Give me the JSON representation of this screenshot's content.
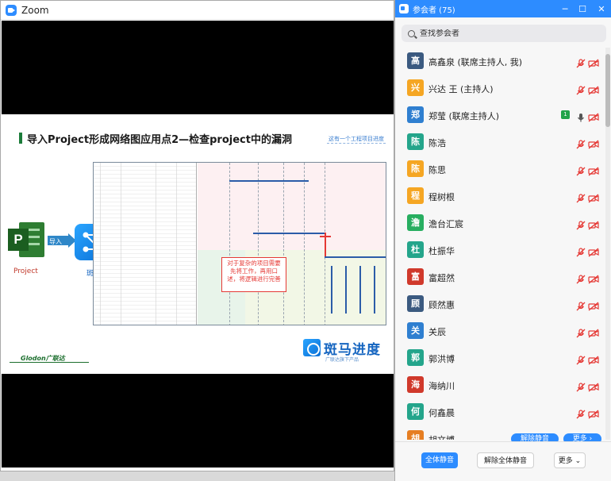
{
  "zoom_window": {
    "title": "Zoom"
  },
  "slide": {
    "title": "导入Project形成网络图应用点2—检查project中的漏洞",
    "tag": "这有一个工程项目进度",
    "project_label": "Project",
    "import_label": "导入",
    "banma_label": "斑马",
    "callout": "对于复杂的项目需要先将工作，再用口述，将逻辑进行完善",
    "brand_name": "斑马进度",
    "brand_slogan": "广联达旗下产品",
    "glodon": "Glodon广联达"
  },
  "panel": {
    "title": "参会者 (75)",
    "search_placeholder": "查找参会者",
    "colors": {
      "accent": "#2d8cff",
      "mic_muted": "#e53935"
    },
    "participants": [
      {
        "initial": "高",
        "name": "高鑫泉 (联席主持人, 我)",
        "color": "#3b5a80",
        "mic": "muted",
        "cam": "off"
      },
      {
        "initial": "兴",
        "name": "兴达 王 (主持人)",
        "color": "#f5a623",
        "mic": "muted",
        "cam": "off"
      },
      {
        "initial": "郑",
        "name": "郑莹 (联席主持人)",
        "color": "#2f7fd0",
        "mic": "on",
        "cam": "off",
        "badge": "1"
      },
      {
        "initial": "陈",
        "name": "陈浩",
        "color": "#24a58b",
        "mic": "muted",
        "cam": "off"
      },
      {
        "initial": "陈",
        "name": "陈思",
        "color": "#f5a623",
        "mic": "muted",
        "cam": "off"
      },
      {
        "initial": "程",
        "name": "程树根",
        "color": "#f5a623",
        "mic": "muted",
        "cam": "off"
      },
      {
        "initial": "澹",
        "name": "澹台汇宸",
        "color": "#27ae60",
        "mic": "muted",
        "cam": "off"
      },
      {
        "initial": "杜",
        "name": "杜振华",
        "color": "#24a58b",
        "mic": "muted",
        "cam": "off"
      },
      {
        "initial": "富",
        "name": "富超然",
        "color": "#d0392b",
        "mic": "muted",
        "cam": "off"
      },
      {
        "initial": "顾",
        "name": "顾然惠",
        "color": "#3b5a80",
        "mic": "muted",
        "cam": "off"
      },
      {
        "initial": "关",
        "name": "关辰",
        "color": "#2f7fd0",
        "mic": "muted",
        "cam": "off"
      },
      {
        "initial": "郭",
        "name": "郭洪博",
        "color": "#24a58b",
        "mic": "muted",
        "cam": "off"
      },
      {
        "initial": "海",
        "name": "海纳川",
        "color": "#d0392b",
        "mic": "muted",
        "cam": "off"
      },
      {
        "initial": "何",
        "name": "何鑫晨",
        "color": "#24a58b",
        "mic": "muted",
        "cam": "off"
      },
      {
        "initial": "胡",
        "name": "胡文博",
        "color": "#e67e22",
        "mic": "muted",
        "cam": "off"
      }
    ],
    "hover_unmute": "解除静音",
    "hover_more": "更多 ›",
    "footer": {
      "mute_all": "全体静音",
      "unmute_all": "解除全体静音",
      "more": "更多 ⌄"
    }
  }
}
